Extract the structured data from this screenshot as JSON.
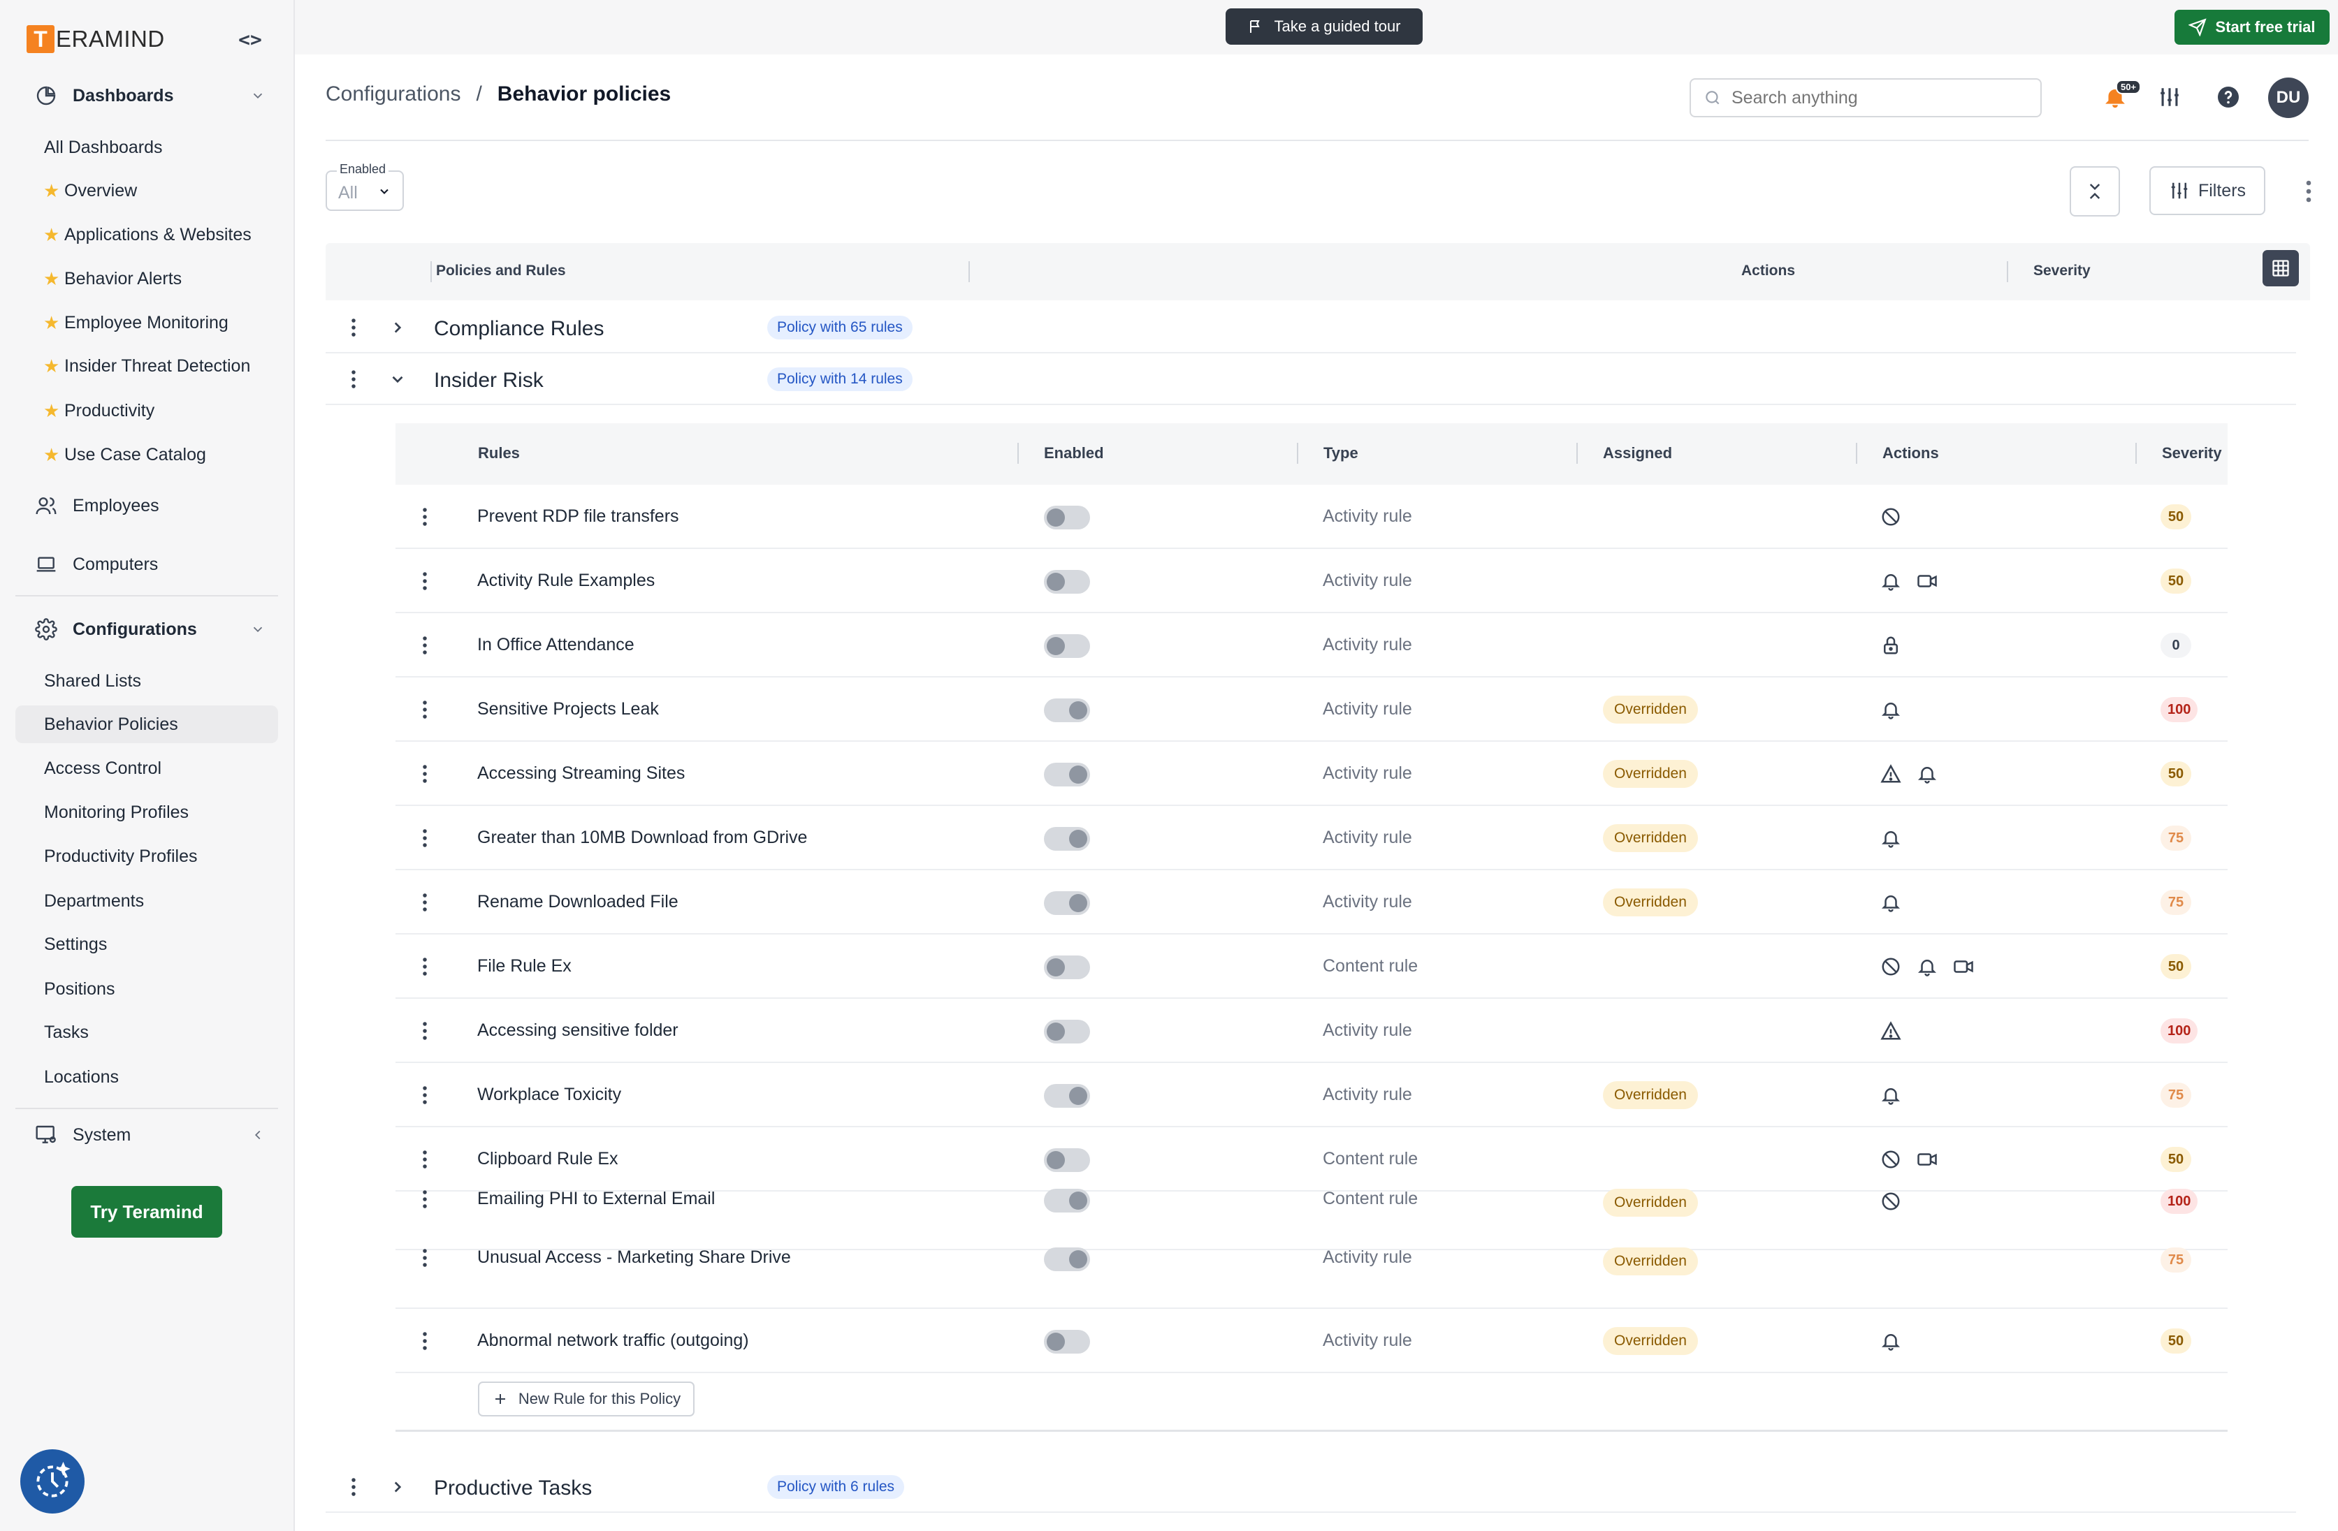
{
  "app": {
    "logo_letter": "T",
    "logo_rest": "ERAMIND",
    "collapse_glyph": "<>"
  },
  "sidebar": {
    "sections": [
      {
        "label": "Dashboards",
        "icon": "pie-chart-icon"
      },
      {
        "label": "Employees",
        "icon": "users-icon"
      },
      {
        "label": "Computers",
        "icon": "laptop-icon"
      },
      {
        "label": "Configurations",
        "icon": "gear-icon"
      },
      {
        "label": "System",
        "icon": "monitor-gear-icon"
      }
    ],
    "dashboards": [
      "All Dashboards",
      "Overview",
      "Applications & Websites",
      "Behavior Alerts",
      "Employee Monitoring",
      "Insider Threat Detection",
      "Productivity",
      "Use Case Catalog"
    ],
    "configurations": [
      "Shared Lists",
      "Behavior Policies",
      "Access Control",
      "Monitoring Profiles",
      "Productivity Profiles",
      "Departments",
      "Settings",
      "Positions",
      "Tasks",
      "Locations"
    ],
    "try_button": "Try Teramind"
  },
  "topbar": {
    "tour_label": "Take a guided tour",
    "trial_label": "Start free trial"
  },
  "header": {
    "breadcrumb_parent": "Configurations",
    "breadcrumb_sep": "/",
    "breadcrumb_current": "Behavior policies",
    "search_placeholder": "Search anything",
    "notif_count": "50+",
    "avatar_initials": "DU"
  },
  "filters": {
    "enabled_label": "Enabled",
    "enabled_value": "All",
    "filters_label": "Filters"
  },
  "outer_table": {
    "columns": [
      "Policies and Rules",
      "Actions",
      "Severity"
    ],
    "policies": [
      {
        "name": "Compliance Rules",
        "badge": "Policy with 65 rules"
      },
      {
        "name": "Insider Risk",
        "badge": "Policy with 14 rules"
      },
      {
        "name": "Productive Tasks",
        "badge": "Policy with 6 rules"
      }
    ]
  },
  "inner_table": {
    "columns": [
      "Rules",
      "Enabled",
      "Type",
      "Assigned",
      "Actions",
      "Severity"
    ],
    "rows": [
      {
        "name": "Prevent RDP file transfers",
        "type": "Activity rule",
        "assigned": "",
        "actions": [
          "block-icon"
        ],
        "severity": "50"
      },
      {
        "name": "Activity Rule Examples",
        "type": "Activity rule",
        "assigned": "",
        "actions": [
          "bell-icon",
          "video-icon"
        ],
        "severity": "50"
      },
      {
        "name": "In Office Attendance",
        "type": "Activity rule",
        "assigned": "",
        "actions": [
          "lock-icon"
        ],
        "severity": "0"
      },
      {
        "name": "Sensitive Projects Leak",
        "type": "Activity rule",
        "assigned": "Overridden",
        "actions": [
          "bell-icon"
        ],
        "severity": "100"
      },
      {
        "name": "Accessing Streaming Sites",
        "type": "Activity rule",
        "assigned": "Overridden",
        "actions": [
          "warning-icon",
          "bell-icon"
        ],
        "severity": "50"
      },
      {
        "name": "Greater than 10MB Download from GDrive",
        "type": "Activity rule",
        "assigned": "Overridden",
        "actions": [
          "bell-icon"
        ],
        "severity": "75"
      },
      {
        "name": "Rename Downloaded File",
        "type": "Activity rule",
        "assigned": "Overridden",
        "actions": [
          "bell-icon"
        ],
        "severity": "75"
      },
      {
        "name": "File Rule Ex",
        "type": "Content rule",
        "assigned": "",
        "actions": [
          "block-icon",
          "bell-icon",
          "video-icon"
        ],
        "severity": "50"
      },
      {
        "name": "Accessing sensitive folder",
        "type": "Activity rule",
        "assigned": "",
        "actions": [
          "warning-icon"
        ],
        "severity": "100"
      },
      {
        "name": "Workplace Toxicity",
        "type": "Activity rule",
        "assigned": "Overridden",
        "actions": [
          "bell-icon"
        ],
        "severity": "75"
      },
      {
        "name": "Clipboard Rule Ex",
        "type": "Content rule",
        "assigned": "",
        "actions": [
          "block-icon",
          "video-icon"
        ],
        "severity": "50"
      },
      {
        "name": "Emailing PHI to External Email",
        "type": "Content rule",
        "assigned": "Overridden",
        "actions": [
          "block-icon"
        ],
        "severity": "100"
      },
      {
        "name": "Unusual Access - Marketing Share Drive",
        "type": "Activity rule",
        "assigned": "Overridden",
        "actions": [],
        "severity": "75"
      },
      {
        "name": "Abnormal network traffic (outgoing)",
        "type": "Activity rule",
        "assigned": "Overridden",
        "actions": [
          "bell-icon"
        ],
        "severity": "50"
      }
    ],
    "new_rule_label": "New Rule for this Policy"
  },
  "colors": {
    "brand_orange": "#f58220",
    "brand_green": "#177a3a",
    "badge_blue": "#e6efff",
    "overridden_bg": "#fdf1d4"
  }
}
